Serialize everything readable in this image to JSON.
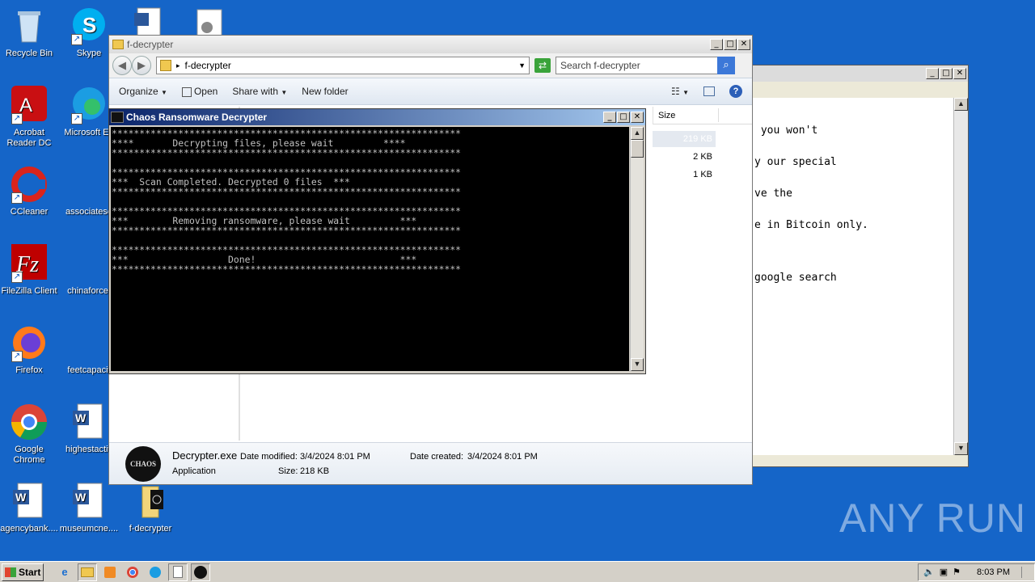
{
  "desktop": {
    "icons": [
      {
        "label": "Recycle Bin",
        "icon": "recycle-bin-icon"
      },
      {
        "label": "Skype",
        "icon": "skype-icon"
      },
      {
        "label": "Acrobat Reader DC",
        "icon": "acrobat-icon"
      },
      {
        "label": "Microsoft Ed",
        "icon": "edge-icon"
      },
      {
        "label": "CCleaner",
        "icon": "ccleaner-icon"
      },
      {
        "label": "associatese",
        "icon": "blank-file-icon"
      },
      {
        "label": "FileZilla Client",
        "icon": "filezilla-icon"
      },
      {
        "label": "chinaforce.",
        "icon": "blank-file-icon"
      },
      {
        "label": "Firefox",
        "icon": "firefox-icon"
      },
      {
        "label": "feetcapacit",
        "icon": "blank-file-icon"
      },
      {
        "label": "Google Chrome",
        "icon": "chrome-icon"
      },
      {
        "label": "highestactiv",
        "icon": "word-doc-icon"
      },
      {
        "label": "agencybank....",
        "icon": "word-doc-icon"
      },
      {
        "label": "museumcne....",
        "icon": "word-doc-icon"
      },
      {
        "label": "f-decrypter",
        "icon": "folder-icon"
      }
    ]
  },
  "note_window": {
    "lines": [
      " you won't",
      "y our special",
      "ve the",
      "e in Bitcoin only.",
      "",
      "google search"
    ]
  },
  "explorer": {
    "title": "f-decrypter",
    "address": "f-decrypter",
    "search_placeholder": "Search f-decrypter",
    "toolbar": {
      "organize": "Organize",
      "open": "Open",
      "share_with": "Share with",
      "new_folder": "New folder"
    },
    "size_header": "Size",
    "sizes": [
      "219 KB",
      "2 KB",
      "1 KB"
    ],
    "details": {
      "name": "Decrypter.exe",
      "type": "Application",
      "modified_label": "Date modified:",
      "modified_value": "3/4/2024 8:01 PM",
      "created_label": "Date created:",
      "created_value": "3/4/2024 8:01 PM",
      "size_label": "Size:",
      "size_value": "218 KB"
    }
  },
  "console": {
    "title": "Chaos Ransomware Decrypter",
    "output": "***************************************************************\n****       Decrypting files, please wait         ****\n***************************************************************\n\n***************************************************************\n***  Scan Completed. Decrypted 0 files  ***\n***************************************************************\n\n***************************************************************\n***        Removing ransomware, please wait         ***\n***************************************************************\n\n***************************************************************\n***                  Done!                          ***\n***************************************************************"
  },
  "taskbar": {
    "start_label": "Start",
    "clock": "8:03 PM"
  },
  "watermark": "ANY RUN",
  "colors": {
    "desktop": "#1565c8",
    "console_bg": "#000000",
    "console_title": "#0a246a"
  }
}
